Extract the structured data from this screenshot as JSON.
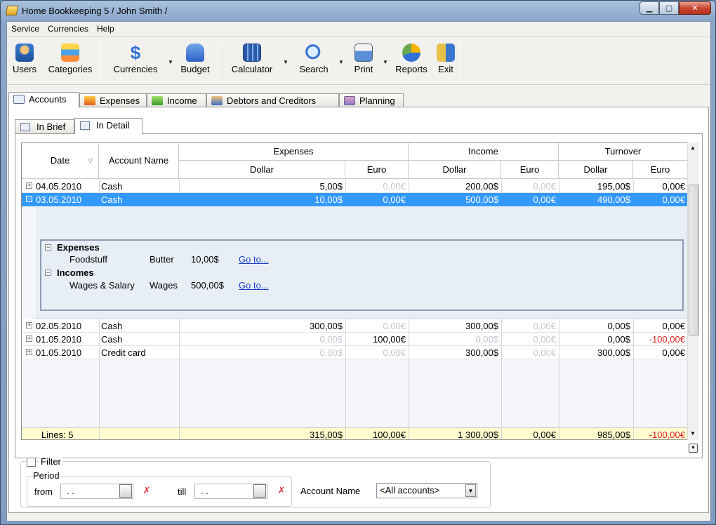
{
  "window": {
    "title": "Home Bookkeeping 5  / John Smith /",
    "min_label": "▁",
    "max_label": "▢",
    "close_label": "✕"
  },
  "menu": [
    "Service",
    "Currencies",
    "Help"
  ],
  "toolbar": {
    "users": "Users",
    "categories": "Categories",
    "currencies": "Currencies",
    "budget": "Budget",
    "calculator": "Calculator",
    "search": "Search",
    "print": "Print",
    "reports": "Reports",
    "exit": "Exit"
  },
  "tabs": [
    "Accounts",
    "Expenses",
    "Income",
    "Debtors and Creditors",
    "Planning"
  ],
  "subtabs": [
    "In Brief",
    "In Detail"
  ],
  "grid": {
    "headers": {
      "date": "Date",
      "account": "Account Name",
      "expenses": "Expenses",
      "income": "Income",
      "turnover": "Turnover",
      "dollar": "Dollar",
      "euro": "Euro"
    },
    "rows": [
      {
        "date": "04.05.2010",
        "account": "Cash",
        "exp_usd": "5,00$",
        "exp_eur": "0,00€",
        "inc_usd": "200,00$",
        "inc_eur": "0,00€",
        "turn_usd": "195,00$",
        "turn_eur": "0,00€",
        "expander": "+"
      },
      {
        "date": "03.05.2010",
        "account": "Cash",
        "exp_usd": "10,00$",
        "exp_eur": "0,00€",
        "inc_usd": "500,00$",
        "inc_eur": "0,00€",
        "turn_usd": "490,00$",
        "turn_eur": "0,00€",
        "expander": "−"
      },
      {
        "date": "02.05.2010",
        "account": "Cash",
        "exp_usd": "300,00$",
        "exp_eur": "0,00€",
        "inc_usd": "300,00$",
        "inc_eur": "0,00€",
        "turn_usd": "0,00$",
        "turn_eur": "0,00€",
        "expander": "+"
      },
      {
        "date": "01.05.2010",
        "account": "Cash",
        "exp_usd": "0,00$",
        "exp_eur": "100,00€",
        "inc_usd": "0,00$",
        "inc_eur": "0,00€",
        "turn_usd": "0,00$",
        "turn_eur": "-100,00€",
        "expander": "+"
      },
      {
        "date": "01.05.2010",
        "account": "Credit card",
        "exp_usd": "0,00$",
        "exp_eur": "0,00€",
        "inc_usd": "300,00$",
        "inc_eur": "0,00€",
        "turn_usd": "300,00$",
        "turn_eur": "0,00€",
        "expander": "+"
      }
    ],
    "detail": {
      "expenses_title": "Expenses",
      "expenses_item": {
        "category": "Foodstuff",
        "name": "Butter",
        "amount": "10,00$",
        "link": "Go to..."
      },
      "incomes_title": "Incomes",
      "incomes_item": {
        "category": "Wages & Salary",
        "name": "Wages",
        "amount": "500,00$",
        "link": "Go to..."
      },
      "expander": "−"
    },
    "footer": {
      "lines": "Lines: 5",
      "exp_usd": "315,00$",
      "exp_eur": "100,00€",
      "inc_usd": "1 300,00$",
      "inc_eur": "0,00€",
      "turn_usd": "985,00$",
      "turn_eur": "-100,00€"
    }
  },
  "filter": {
    "label": "Filter",
    "period_label": "Period",
    "from_label": "from",
    "from_value": " .  .",
    "till_label": "till",
    "till_value": " .  .",
    "account_label": "Account Name",
    "account_value": "<All accounts>"
  },
  "colors": {
    "selection": "#3399ff",
    "negative": "#e02020",
    "footer_bg": "#fffccf"
  }
}
